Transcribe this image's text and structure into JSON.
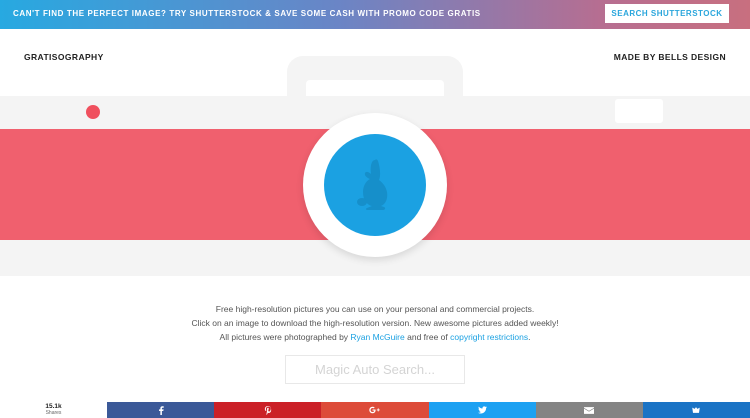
{
  "promo": {
    "text": "CAN'T FIND THE PERFECT IMAGE? TRY SHUTTERSTOCK & SAVE SOME CASH WITH PROMO CODE GRATIS",
    "button_label": "SEARCH SHUTTERSTOCK"
  },
  "header": {
    "brand": "GRATISOGRAPHY",
    "credit": "MADE BY BELLS DESIGN"
  },
  "hero": {
    "lens_icon": "rabbit-icon",
    "colors": {
      "stripe": "#f0606e",
      "lens": "#1ba1e2",
      "body": "#f4f4f4"
    }
  },
  "intro": {
    "line1": "Free high-resolution pictures you can use on your personal and commercial projects.",
    "line2": "Click on an image to download the high-resolution version. New awesome pictures added weekly!",
    "line3_prefix": "All pictures were photographed by ",
    "line3_author": "Ryan McGuire",
    "line3_middle": " and free of ",
    "line3_link": "copyright restrictions",
    "line3_suffix": "."
  },
  "search": {
    "placeholder": "Magic Auto Search..."
  },
  "share": {
    "count": "15.1k",
    "count_label": "Shares",
    "buttons": [
      {
        "icon": "facebook-icon",
        "color": "#3b5998"
      },
      {
        "icon": "pinterest-icon",
        "color": "#cb2027"
      },
      {
        "icon": "google-plus-icon",
        "color": "#dd4b39"
      },
      {
        "icon": "twitter-icon",
        "color": "#1da1f2"
      },
      {
        "icon": "email-icon",
        "color": "#848484"
      },
      {
        "icon": "sumo-icon",
        "color": "#1a73c5"
      }
    ]
  }
}
